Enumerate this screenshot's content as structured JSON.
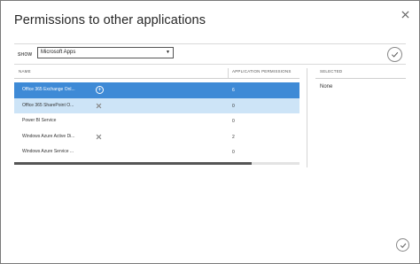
{
  "dialog": {
    "title": "Permissions to other applications"
  },
  "filter": {
    "label": "SHOW",
    "selected": "Microsoft Apps",
    "caret": "▼"
  },
  "columns": {
    "name": "NAME",
    "permissions": "APPLICATION PERMISSIONS",
    "selected": "SELECTED"
  },
  "rows": [
    {
      "name": "Office 365 Exchange Onl...",
      "permissions": "6",
      "state": "selected",
      "action": "add-icon"
    },
    {
      "name": "Office 365 SharePoint O...",
      "permissions": "0",
      "state": "hover",
      "action": "remove-icon"
    },
    {
      "name": "Power BI Service",
      "permissions": "0",
      "state": "normal",
      "action": ""
    },
    {
      "name": "Windows Azure Active Di...",
      "permissions": "2",
      "state": "normal",
      "action": "remove-icon"
    },
    {
      "name": "Windows Azure Service ...",
      "permissions": "0",
      "state": "normal",
      "action": ""
    }
  ],
  "selected_panel": {
    "value": "None"
  },
  "scroll": {
    "position_fraction": 0.83
  },
  "colors": {
    "selected_row": "#3e8ad6",
    "hover_row": "#cde4f7"
  }
}
